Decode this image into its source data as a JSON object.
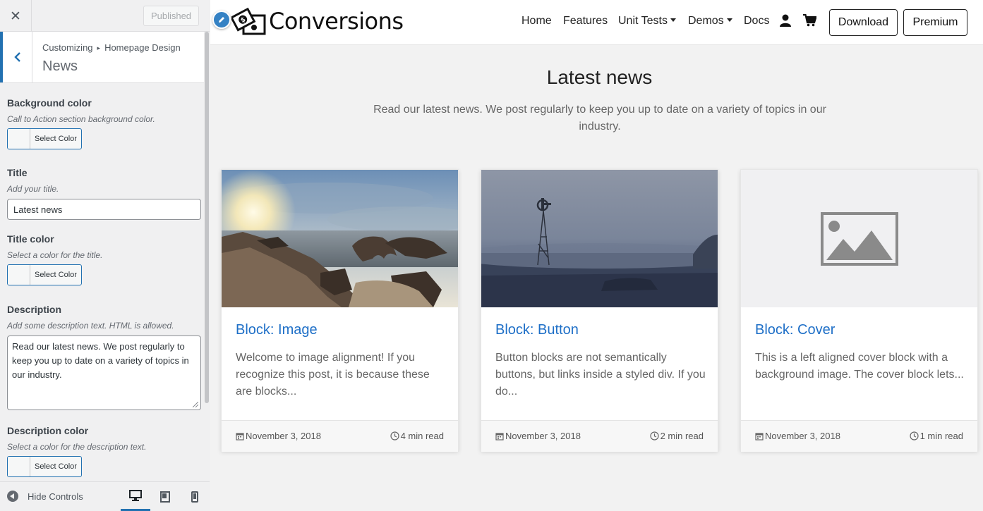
{
  "sidebar": {
    "close_label": "✕",
    "published_label": "Published",
    "breadcrumb": {
      "parent": "Customizing",
      "separator": "▸",
      "current": "Homepage Design"
    },
    "section_title": "News",
    "controls": {
      "bg_color": {
        "label": "Background color",
        "desc": "Call to Action section background color.",
        "button": "Select Color"
      },
      "title": {
        "label": "Title",
        "desc": "Add your title.",
        "value": "Latest news"
      },
      "title_color": {
        "label": "Title color",
        "desc": "Select a color for the title.",
        "button": "Select Color"
      },
      "description": {
        "label": "Description",
        "desc": "Add some description text. HTML is allowed.",
        "value": "Read our latest news. We post regularly to keep you up to date on a variety of topics in our industry."
      },
      "desc_color": {
        "label": "Description color",
        "desc": "Select a color for the description text.",
        "button": "Select Color"
      }
    },
    "footer": {
      "hide_controls": "Hide Controls",
      "devices": [
        "desktop-icon",
        "tablet-icon",
        "mobile-icon"
      ],
      "active_device": "desktop"
    },
    "accent_color": "#2271b1"
  },
  "preview": {
    "brand": "Conversions",
    "nav": {
      "home": "Home",
      "features": "Features",
      "unit_tests": "Unit Tests",
      "demos": "Demos",
      "docs": "Docs",
      "download": "Download",
      "premium": "Premium"
    },
    "section": {
      "title": "Latest news",
      "description": "Read our latest news. We post regularly to keep you up to date on a variety of topics in our industry."
    },
    "cards": [
      {
        "title": "Block: Image",
        "excerpt": "Welcome to image alignment! If you recognize this post, it is because these are blocks...",
        "date": "November 3, 2018",
        "read": "4 min read",
        "image": "beach-sunset-photo"
      },
      {
        "title": "Block: Button",
        "excerpt": "Button blocks are not semantically buttons, but links inside a styled div.  If you do...",
        "date": "November 3, 2018",
        "read": "2 min read",
        "image": "foggy-windmill-photo"
      },
      {
        "title": "Block: Cover",
        "excerpt": "This is a left aligned cover block with a background image. The cover block lets...",
        "date": "November 3, 2018",
        "read": "1 min read",
        "image": "image-placeholder-icon"
      }
    ],
    "link_color": "#1e6fc7"
  }
}
